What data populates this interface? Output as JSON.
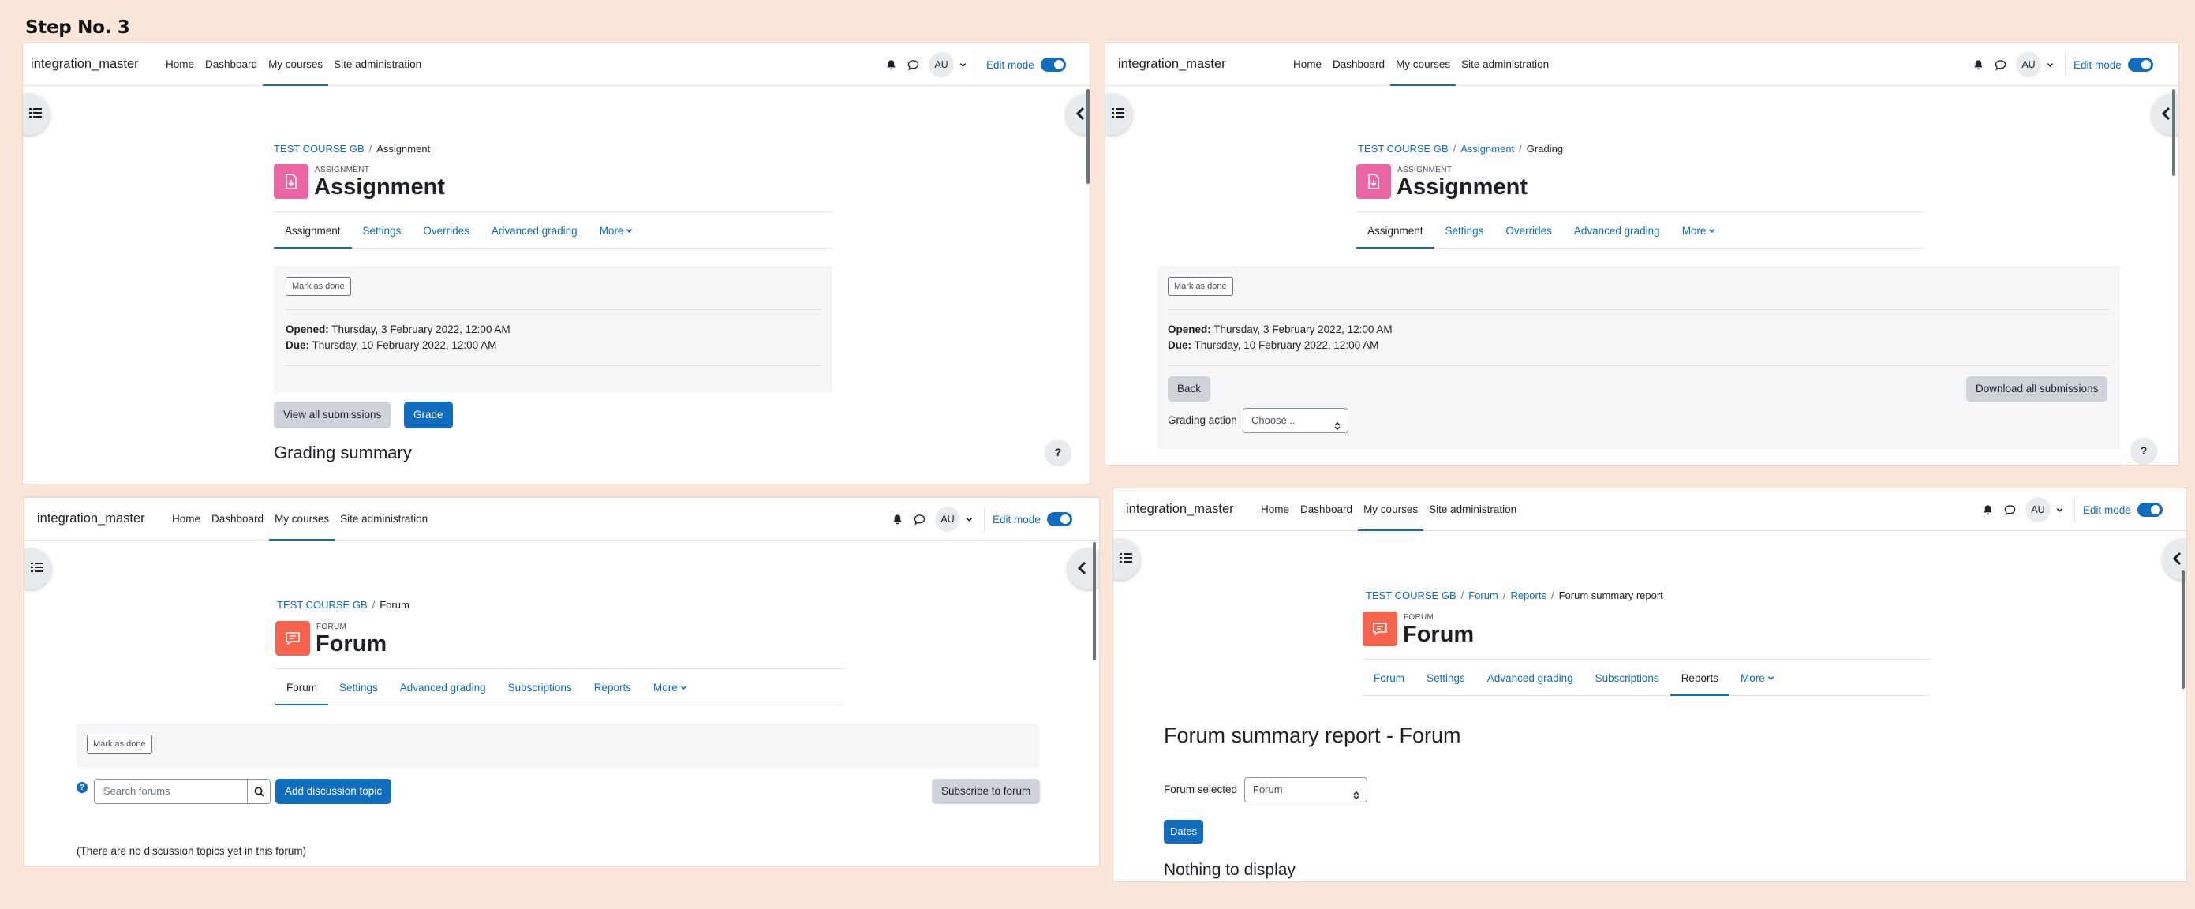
{
  "step_title": "Step No. 3",
  "common": {
    "site_name": "integration_master",
    "nav": [
      "Home",
      "Dashboard",
      "My courses",
      "Site administration"
    ],
    "avatar_initials": "AU",
    "edit_mode_label": "Edit mode",
    "icons": [
      "bell-icon",
      "chat-icon",
      "chevron-down-icon",
      "list-icon",
      "chevron-left-icon",
      "search-icon"
    ]
  },
  "panel_assignment": {
    "breadcrumb": [
      "TEST COURSE GB",
      "Assignment"
    ],
    "module_label": "ASSIGNMENT",
    "module_title": "Assignment",
    "tabs": [
      "Assignment",
      "Settings",
      "Overrides",
      "Advanced grading",
      "More"
    ],
    "mark_done": "Mark as done",
    "opened_label": "Opened:",
    "opened_value": "Thursday, 3 February 2022, 12:00 AM",
    "due_label": "Due:",
    "due_value": "Thursday, 10 February 2022, 12:00 AM",
    "view_all_submissions": "View all submissions",
    "grade": "Grade",
    "grading_summary": "Grading summary",
    "help": "?"
  },
  "panel_grading": {
    "breadcrumb": [
      "TEST COURSE GB",
      "Assignment",
      "Grading"
    ],
    "module_label": "ASSIGNMENT",
    "module_title": "Assignment",
    "tabs": [
      "Assignment",
      "Settings",
      "Overrides",
      "Advanced grading",
      "More"
    ],
    "mark_done": "Mark as done",
    "opened_label": "Opened:",
    "opened_value": "Thursday, 3 February 2022, 12:00 AM",
    "due_label": "Due:",
    "due_value": "Thursday, 10 February 2022, 12:00 AM",
    "back": "Back",
    "download_all": "Download all submissions",
    "grading_action_label": "Grading action",
    "grading_action_value": "Choose...",
    "help": "?"
  },
  "panel_forum": {
    "breadcrumb": [
      "TEST COURSE GB",
      "Forum"
    ],
    "module_label": "FORUM",
    "module_title": "Forum",
    "tabs": [
      "Forum",
      "Settings",
      "Advanced grading",
      "Subscriptions",
      "Reports",
      "More"
    ],
    "mark_done": "Mark as done",
    "search_placeholder": "Search forums",
    "add_topic": "Add discussion topic",
    "subscribe": "Subscribe to forum",
    "empty_message": "(There are no discussion topics yet in this forum)"
  },
  "panel_report": {
    "breadcrumb": [
      "TEST COURSE GB",
      "Forum",
      "Reports",
      "Forum summary report"
    ],
    "module_label": "FORUM",
    "module_title": "Forum",
    "tabs": [
      "Forum",
      "Settings",
      "Advanced grading",
      "Subscriptions",
      "Reports",
      "More"
    ],
    "report_title": "Forum summary report - Forum",
    "forum_selected_label": "Forum selected",
    "forum_selected_value": "Forum",
    "dates_button": "Dates",
    "nothing": "Nothing to display"
  }
}
